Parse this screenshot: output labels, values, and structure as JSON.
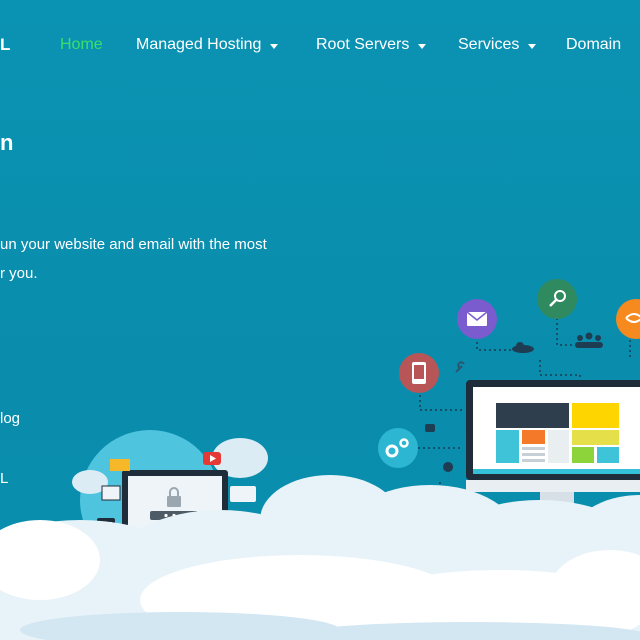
{
  "brand": {
    "logo_fragment": "L"
  },
  "nav": {
    "items": [
      {
        "label": "Home",
        "active": true,
        "dropdown": false
      },
      {
        "label": "Managed Hosting",
        "active": false,
        "dropdown": true
      },
      {
        "label": "Root Servers",
        "active": false,
        "dropdown": true
      },
      {
        "label": "Services",
        "active": false,
        "dropdown": true
      },
      {
        "label": "Domain",
        "active": false,
        "dropdown": false
      }
    ]
  },
  "hero": {
    "title_fragment": "n",
    "line1": "un your website and email with the most",
    "line2": "r you."
  },
  "side": {
    "link1": "log",
    "link2": "L"
  },
  "colors": {
    "background": "#0a8fae",
    "active_nav": "#37e06a",
    "accent_orange": "#f7931e",
    "accent_purple": "#6a5acd",
    "accent_green": "#2e8b57"
  },
  "icons": [
    "email-icon",
    "search-icon",
    "settings-icon",
    "phone-icon",
    "gear-icon",
    "user-icon",
    "lock-icon",
    "play-icon",
    "envelope-icon",
    "monitor-icon",
    "location-icon",
    "cloud-icon",
    "people-icon",
    "link-icon"
  ]
}
